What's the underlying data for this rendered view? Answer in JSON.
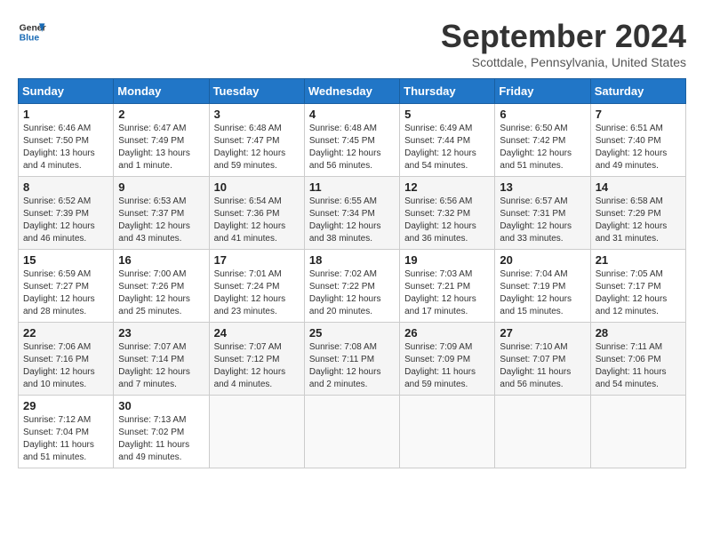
{
  "header": {
    "logo_line1": "General",
    "logo_line2": "Blue",
    "month_title": "September 2024",
    "location": "Scottdale, Pennsylvania, United States"
  },
  "days_of_week": [
    "Sunday",
    "Monday",
    "Tuesday",
    "Wednesday",
    "Thursday",
    "Friday",
    "Saturday"
  ],
  "weeks": [
    [
      {
        "day": "1",
        "sunrise": "6:46 AM",
        "sunset": "7:50 PM",
        "daylight": "13 hours and 4 minutes."
      },
      {
        "day": "2",
        "sunrise": "6:47 AM",
        "sunset": "7:49 PM",
        "daylight": "13 hours and 1 minute."
      },
      {
        "day": "3",
        "sunrise": "6:48 AM",
        "sunset": "7:47 PM",
        "daylight": "12 hours and 59 minutes."
      },
      {
        "day": "4",
        "sunrise": "6:48 AM",
        "sunset": "7:45 PM",
        "daylight": "12 hours and 56 minutes."
      },
      {
        "day": "5",
        "sunrise": "6:49 AM",
        "sunset": "7:44 PM",
        "daylight": "12 hours and 54 minutes."
      },
      {
        "day": "6",
        "sunrise": "6:50 AM",
        "sunset": "7:42 PM",
        "daylight": "12 hours and 51 minutes."
      },
      {
        "day": "7",
        "sunrise": "6:51 AM",
        "sunset": "7:40 PM",
        "daylight": "12 hours and 49 minutes."
      }
    ],
    [
      {
        "day": "8",
        "sunrise": "6:52 AM",
        "sunset": "7:39 PM",
        "daylight": "12 hours and 46 minutes."
      },
      {
        "day": "9",
        "sunrise": "6:53 AM",
        "sunset": "7:37 PM",
        "daylight": "12 hours and 43 minutes."
      },
      {
        "day": "10",
        "sunrise": "6:54 AM",
        "sunset": "7:36 PM",
        "daylight": "12 hours and 41 minutes."
      },
      {
        "day": "11",
        "sunrise": "6:55 AM",
        "sunset": "7:34 PM",
        "daylight": "12 hours and 38 minutes."
      },
      {
        "day": "12",
        "sunrise": "6:56 AM",
        "sunset": "7:32 PM",
        "daylight": "12 hours and 36 minutes."
      },
      {
        "day": "13",
        "sunrise": "6:57 AM",
        "sunset": "7:31 PM",
        "daylight": "12 hours and 33 minutes."
      },
      {
        "day": "14",
        "sunrise": "6:58 AM",
        "sunset": "7:29 PM",
        "daylight": "12 hours and 31 minutes."
      }
    ],
    [
      {
        "day": "15",
        "sunrise": "6:59 AM",
        "sunset": "7:27 PM",
        "daylight": "12 hours and 28 minutes."
      },
      {
        "day": "16",
        "sunrise": "7:00 AM",
        "sunset": "7:26 PM",
        "daylight": "12 hours and 25 minutes."
      },
      {
        "day": "17",
        "sunrise": "7:01 AM",
        "sunset": "7:24 PM",
        "daylight": "12 hours and 23 minutes."
      },
      {
        "day": "18",
        "sunrise": "7:02 AM",
        "sunset": "7:22 PM",
        "daylight": "12 hours and 20 minutes."
      },
      {
        "day": "19",
        "sunrise": "7:03 AM",
        "sunset": "7:21 PM",
        "daylight": "12 hours and 17 minutes."
      },
      {
        "day": "20",
        "sunrise": "7:04 AM",
        "sunset": "7:19 PM",
        "daylight": "12 hours and 15 minutes."
      },
      {
        "day": "21",
        "sunrise": "7:05 AM",
        "sunset": "7:17 PM",
        "daylight": "12 hours and 12 minutes."
      }
    ],
    [
      {
        "day": "22",
        "sunrise": "7:06 AM",
        "sunset": "7:16 PM",
        "daylight": "12 hours and 10 minutes."
      },
      {
        "day": "23",
        "sunrise": "7:07 AM",
        "sunset": "7:14 PM",
        "daylight": "12 hours and 7 minutes."
      },
      {
        "day": "24",
        "sunrise": "7:07 AM",
        "sunset": "7:12 PM",
        "daylight": "12 hours and 4 minutes."
      },
      {
        "day": "25",
        "sunrise": "7:08 AM",
        "sunset": "7:11 PM",
        "daylight": "12 hours and 2 minutes."
      },
      {
        "day": "26",
        "sunrise": "7:09 AM",
        "sunset": "7:09 PM",
        "daylight": "11 hours and 59 minutes."
      },
      {
        "day": "27",
        "sunrise": "7:10 AM",
        "sunset": "7:07 PM",
        "daylight": "11 hours and 56 minutes."
      },
      {
        "day": "28",
        "sunrise": "7:11 AM",
        "sunset": "7:06 PM",
        "daylight": "11 hours and 54 minutes."
      }
    ],
    [
      {
        "day": "29",
        "sunrise": "7:12 AM",
        "sunset": "7:04 PM",
        "daylight": "11 hours and 51 minutes."
      },
      {
        "day": "30",
        "sunrise": "7:13 AM",
        "sunset": "7:02 PM",
        "daylight": "11 hours and 49 minutes."
      },
      null,
      null,
      null,
      null,
      null
    ]
  ]
}
